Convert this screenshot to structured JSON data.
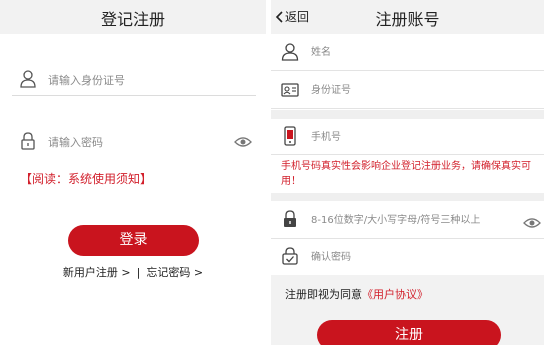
{
  "login_screen": {
    "title": "登记注册",
    "id_field": {
      "placeholder": "请输入身份证号",
      "value": ""
    },
    "password_field": {
      "placeholder": "请输入密码",
      "value": ""
    },
    "notice": "【阅读：系统使用须知】",
    "login_button": "登录",
    "register_link": "新用户注册 >",
    "separator": "|",
    "forgot_link": "忘记密码 >"
  },
  "register_screen": {
    "back_label": "返回",
    "title": "注册账号",
    "name_field": {
      "placeholder": "姓名",
      "value": ""
    },
    "id_field": {
      "placeholder": "身份证号",
      "value": ""
    },
    "phone_field": {
      "placeholder": "手机号",
      "value": ""
    },
    "phone_warning": "手机号码真实性会影响企业登记注册业务，请确保真实可用！",
    "password_field": {
      "placeholder": "8-16位数字/大小写字母/符号三种以上",
      "value": ""
    },
    "confirm_field": {
      "placeholder": "确认密码",
      "value": ""
    },
    "agreement_prefix": "注册即视为同意",
    "agreement_link": "《用户协议》",
    "register_button": "注册"
  },
  "icons": {
    "user": "user-icon",
    "lock": "lock-icon",
    "eye": "eye-icon",
    "id_card": "id-card-icon",
    "phone": "phone-icon",
    "confirm": "confirm-check-icon",
    "back": "chevron-left-icon"
  },
  "colors": {
    "accent": "#c9141e",
    "warning_text": "#d21f2b",
    "header_bg": "#f2f2f2"
  }
}
